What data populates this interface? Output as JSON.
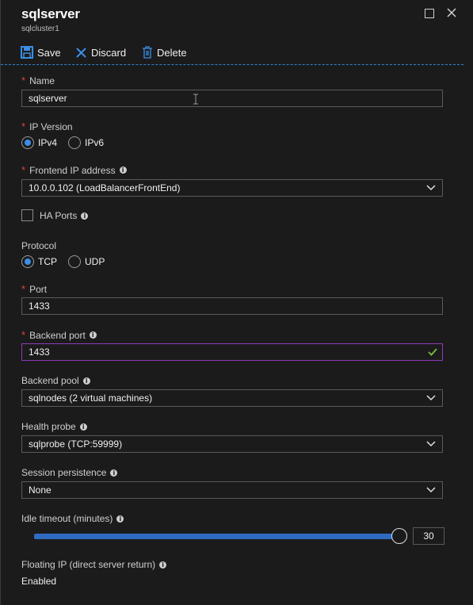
{
  "header": {
    "title": "sqlserver",
    "subtitle": "sqlcluster1"
  },
  "toolbar": {
    "save_label": "Save",
    "discard_label": "Discard",
    "delete_label": "Delete"
  },
  "colors": {
    "accent": "#3b8ee6",
    "required": "#e0443a",
    "valid_border": "#8e3bb8",
    "valid_check": "#7bbd3a"
  },
  "form": {
    "name": {
      "label": "Name",
      "value": "sqlserver"
    },
    "ip_version": {
      "label": "IP Version",
      "options": [
        "IPv4",
        "IPv6"
      ],
      "selected": "IPv4"
    },
    "frontend_ip": {
      "label": "Frontend IP address",
      "value": "10.0.0.102 (LoadBalancerFrontEnd)"
    },
    "ha_ports": {
      "label": "HA Ports",
      "checked": false
    },
    "protocol": {
      "label": "Protocol",
      "options": [
        "TCP",
        "UDP"
      ],
      "selected": "TCP"
    },
    "port": {
      "label": "Port",
      "value": "1433"
    },
    "backend_port": {
      "label": "Backend port",
      "value": "1433"
    },
    "backend_pool": {
      "label": "Backend pool",
      "value": "sqlnodes (2 virtual machines)"
    },
    "health_probe": {
      "label": "Health probe",
      "value": "sqlprobe (TCP:59999)"
    },
    "session_persistence": {
      "label": "Session persistence",
      "value": "None"
    },
    "idle_timeout": {
      "label": "Idle timeout (minutes)",
      "value": "30",
      "fraction": 1.0
    },
    "floating_ip": {
      "label": "Floating IP (direct server return)",
      "value": "Enabled"
    }
  }
}
